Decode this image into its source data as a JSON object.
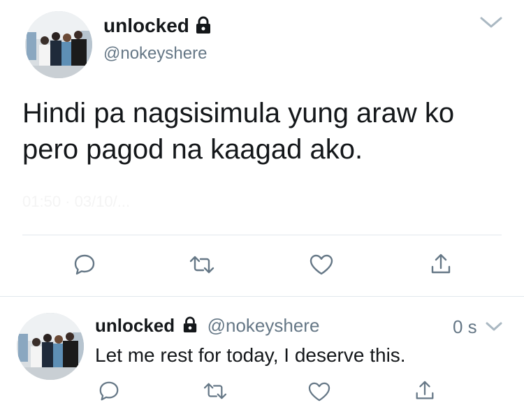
{
  "main_tweet": {
    "display_name": "unlocked",
    "handle": "@nokeyshere",
    "text_line1": "Hindi pa nagsisimula yung araw ko",
    "text_line2": "pero pagod na kaagad ako.",
    "timestamp": "01:50 · 03/10/..."
  },
  "reply_tweet": {
    "display_name": "unlocked",
    "handle": "@nokeyshere",
    "time": "0 s",
    "text": "Let me rest for today, I deserve this."
  },
  "icons": [
    "lock-icon",
    "chevron-down-icon",
    "reply-icon",
    "retweet-icon",
    "like-icon",
    "share-icon"
  ],
  "colors": {
    "icon_gray": "#657786",
    "chevron_gray": "#aab8c2",
    "divider": "#e1e8ed"
  }
}
